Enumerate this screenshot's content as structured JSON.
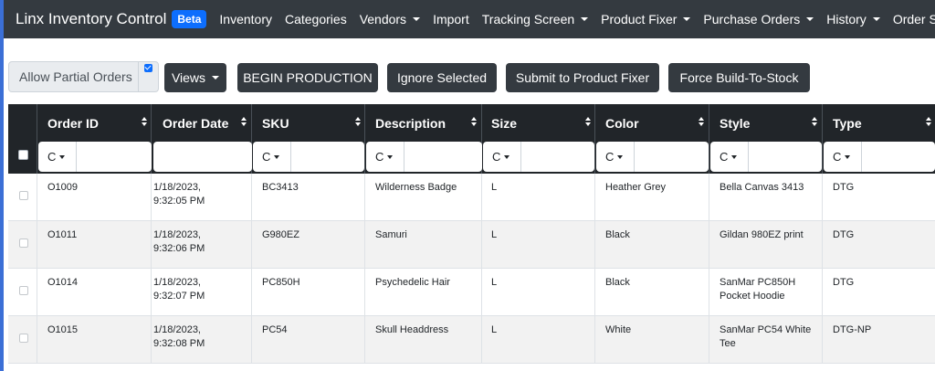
{
  "navbar": {
    "brand": "Linx Inventory Control",
    "badge": "Beta",
    "items": [
      {
        "label": "Inventory",
        "dropdown": false
      },
      {
        "label": "Categories",
        "dropdown": false
      },
      {
        "label": "Vendors",
        "dropdown": true
      },
      {
        "label": "Import",
        "dropdown": false
      },
      {
        "label": "Tracking Screen",
        "dropdown": true
      },
      {
        "label": "Product Fixer",
        "dropdown": true
      },
      {
        "label": "Purchase Orders",
        "dropdown": true
      },
      {
        "label": "History",
        "dropdown": true
      },
      {
        "label": "Order Su",
        "dropdown": false
      }
    ]
  },
  "toolbar": {
    "allow_partial_label": "Allow Partial Orders",
    "allow_partial_checked": true,
    "views_label": "Views",
    "begin_production_label": "BEGIN PRODUCTION",
    "ignore_selected_label": "Ignore Selected",
    "submit_fixer_label": "Submit to Product Fixer",
    "force_build_label": "Force Build-To-Stock"
  },
  "table": {
    "columns": [
      "Order ID",
      "Order Date",
      "SKU",
      "Description",
      "Size",
      "Color",
      "Style",
      "Type"
    ],
    "filter_mode": "C",
    "rows": [
      {
        "order_id": "O1009",
        "date_line1": "1/18/2023,",
        "date_line2": "9:32:05 PM",
        "sku": "BC3413",
        "description": "Wilderness Badge",
        "size": "L",
        "color": "Heather Grey",
        "style_line1": "Bella Canvas 3413",
        "style_line2": "",
        "type": "DTG"
      },
      {
        "order_id": "O1011",
        "date_line1": "1/18/2023,",
        "date_line2": "9:32:06 PM",
        "sku": "G980EZ",
        "description": "Samuri",
        "size": "L",
        "color": "Black",
        "style_line1": "Gildan 980EZ print",
        "style_line2": "",
        "type": "DTG"
      },
      {
        "order_id": "O1014",
        "date_line1": "1/18/2023,",
        "date_line2": "9:32:07 PM",
        "sku": "PC850H",
        "description": "Psychedelic Hair",
        "size": "L",
        "color": "Black",
        "style_line1": "SanMar PC850H",
        "style_line2": "Pocket Hoodie",
        "type": "DTG"
      },
      {
        "order_id": "O1015",
        "date_line1": "1/18/2023,",
        "date_line2": "9:32:08 PM",
        "sku": "PC54",
        "description": "Skull Headdress",
        "size": "L",
        "color": "White",
        "style_line1": "SanMar PC54 White",
        "style_line2": "Tee",
        "type": "DTG-NP"
      }
    ]
  }
}
